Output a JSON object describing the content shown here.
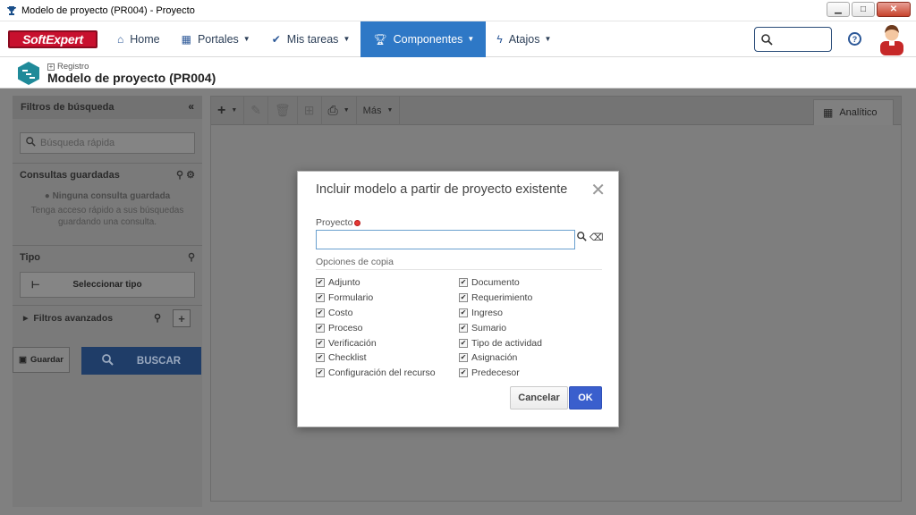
{
  "window": {
    "title": "Modelo de proyecto (PR004) - Proyecto",
    "icon": "trophy-icon",
    "controls": {
      "minimize": "▁",
      "maximize": "□",
      "close": "✕"
    }
  },
  "nav": {
    "logo": "SoftExpert",
    "items": [
      {
        "label": "Home",
        "icon": "home-icon",
        "caret": false
      },
      {
        "label": "Portales",
        "icon": "dashboard-icon",
        "caret": true
      },
      {
        "label": "Mis tareas",
        "icon": "check-icon",
        "caret": true
      },
      {
        "label": "Componentes",
        "icon": "trophy-icon",
        "caret": true,
        "active": true
      },
      {
        "label": "Atajos",
        "icon": "bolt-icon",
        "caret": true
      }
    ],
    "search_placeholder": "",
    "help": "?"
  },
  "header": {
    "breadcrumb": "Registro",
    "title": "Modelo de proyecto (PR004)"
  },
  "left_panel": {
    "title": "Filtros de búsqueda",
    "search_placeholder": "Búsqueda rápida",
    "saved_title": "Consultas guardadas",
    "saved_empty_title": "Ninguna consulta guardada",
    "saved_empty_text": "Tenga acceso rápido a sus búsquedas guardando una consulta.",
    "type_title": "Tipo",
    "type_button": "Seleccionar tipo",
    "advanced": "Filtros avanzados",
    "save_button": "Guardar",
    "search_button": "BUSCAR"
  },
  "toolbar": {
    "more": "Más",
    "tab": "Analítico"
  },
  "modal": {
    "title": "Incluir modelo a partir de proyecto existente",
    "field_label": "Proyecto",
    "field_value": "",
    "copy_options_title": "Opciones de copia",
    "col1": [
      "Adjunto",
      "Formulario",
      "Costo",
      "Proceso",
      "Verificación",
      "Checklist",
      "Configuración del recurso"
    ],
    "col2": [
      "Documento",
      "Requerimiento",
      "Ingreso",
      "Sumario",
      "Tipo de actividad",
      "Asignación",
      "Predecesor"
    ],
    "cancel": "Cancelar",
    "ok": "OK"
  },
  "colors": {
    "accent": "#2e78c6",
    "ok_button": "#3a5fcd",
    "brand": "#c8102e",
    "overlay": "#808080"
  }
}
